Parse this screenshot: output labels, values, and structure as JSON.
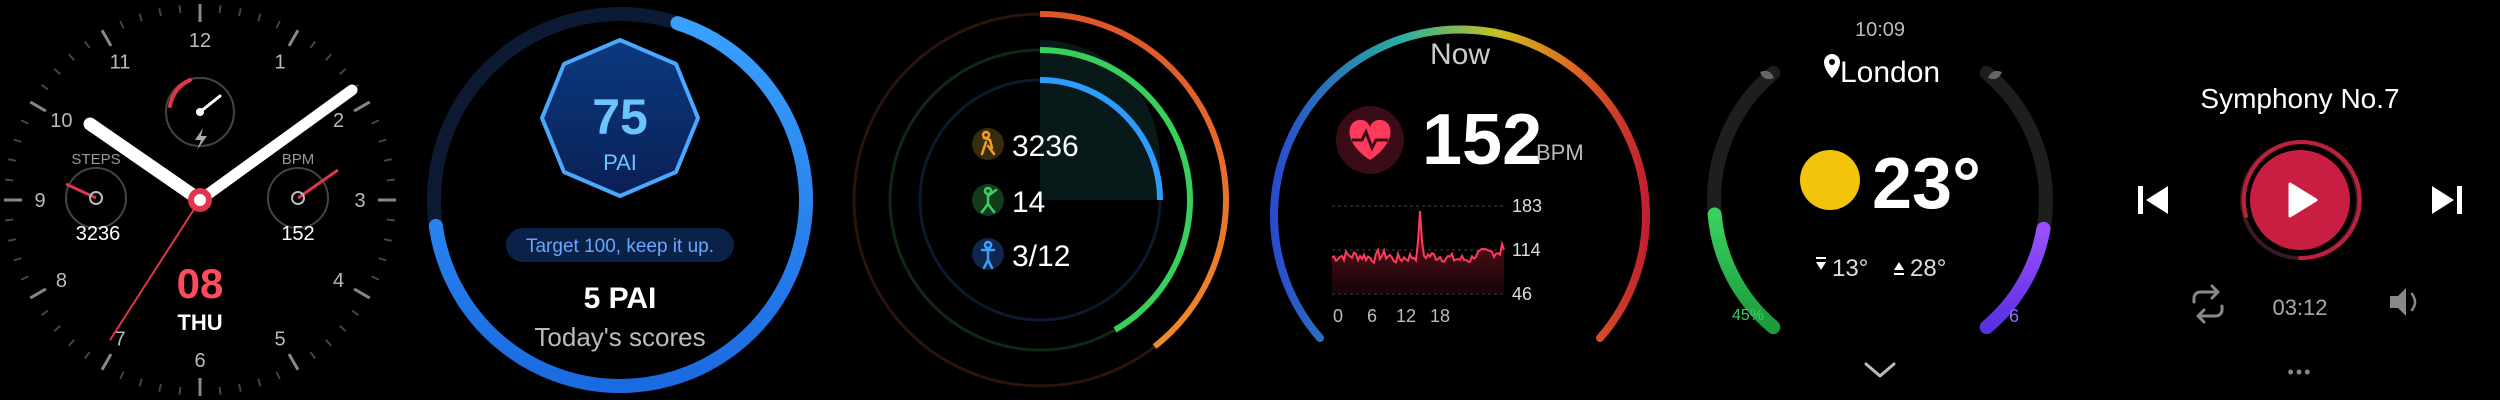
{
  "watch": {
    "hours": [
      "12",
      "1",
      "2",
      "3",
      "4",
      "5",
      "6",
      "7",
      "8",
      "9",
      "10",
      "11"
    ],
    "steps_label": "STEPS",
    "steps_value": "3236",
    "bpm_label": "BPM",
    "bpm_value": "152",
    "date": "08",
    "day": "THU"
  },
  "pai": {
    "value": "75",
    "unit": "PAI",
    "target_text": "Target 100, keep it up.",
    "score": "5 PAI",
    "score_caption": "Today's scores"
  },
  "activity": {
    "steps": "3236",
    "calories": "14",
    "stand": "3/12"
  },
  "heart": {
    "title": "Now",
    "value": "152",
    "unit": "BPM",
    "y_ticks": [
      "183",
      "114",
      "46"
    ],
    "x_ticks": [
      "0",
      "6",
      "12",
      "18"
    ]
  },
  "weather": {
    "time": "10:09",
    "city": "London",
    "temp": "23°",
    "low": "13°",
    "high": "28°",
    "left_pct": "45%",
    "right_value": "6",
    "left_fill": 0.45,
    "right_fill": 0.4
  },
  "music": {
    "title": "Symphony No.7",
    "time": "03:12",
    "more": "•••"
  }
}
